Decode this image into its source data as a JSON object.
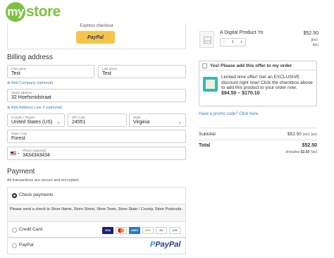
{
  "brand": {
    "logo_my": "my",
    "logo_store": "store",
    "color": "#7cc242"
  },
  "express": {
    "title": "Express checkout",
    "paypal_label": "PayPal"
  },
  "billing": {
    "title": "Billing address",
    "first_name": {
      "label": "First name",
      "value": "Test"
    },
    "last_name": {
      "label": "Last name",
      "value": "Test"
    },
    "add_company": "Add Company (optional)",
    "street": {
      "label": "Street address",
      "value": "32 Hoefsmidstraat"
    },
    "add_line2": "Add Address Line 2 (optional)",
    "country": {
      "label": "Country / Region",
      "value": "United States (US)"
    },
    "zip": {
      "label": "ZIP Code",
      "value": "24551"
    },
    "state": {
      "label": "State",
      "value": "Virginia"
    },
    "city": {
      "label": "Town / City",
      "value": "Forest"
    },
    "phone": {
      "label": "Phone (optional)",
      "value": "3434343434",
      "flag": "us-flag-icon"
    }
  },
  "payment": {
    "title": "Payment",
    "subtitle": "All transactions are secure and encrypted.",
    "check": {
      "label": "Check payments",
      "selected": true,
      "description": "Please send a check to Store Name, Store Street, Store Town, Store State / County, Store Postcode."
    },
    "card": {
      "label": "Credit Card",
      "icons": [
        "VISA",
        "MC",
        "AMEX",
        "DISC",
        "DC",
        "JCB"
      ]
    },
    "paypal": {
      "label": "PayPal",
      "logo": "PayPal"
    }
  },
  "cart": {
    "product": {
      "name": "A Digital Product Yo",
      "price": "$52.50",
      "tax_note_1": "(incl.",
      "tax_note_2": "tax)",
      "qty": "1",
      "minus": "−",
      "plus": "+"
    },
    "offer": {
      "header": "Yes! Please add this offer to my order",
      "text": "Limited time offer! Get an EXCLUSIVE discount right now! Click the checkbox above to add this product to your order now.",
      "price": "$94.50 – $170.10"
    },
    "promo_link": "Have a promo code? Click here.",
    "subtotal": {
      "label": "Subtotal",
      "value": "$52.50",
      "note": "(incl. tax)"
    },
    "total": {
      "label": "Total",
      "value": "$52.50",
      "includes_prefix": "(includes",
      "includes_amount": "$2.50",
      "includes_suffix": "Tax)"
    }
  }
}
